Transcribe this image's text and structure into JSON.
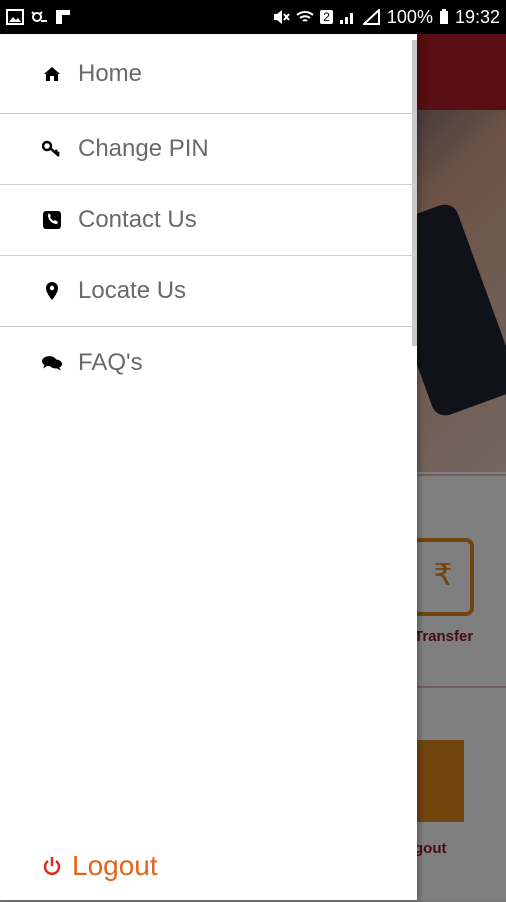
{
  "status_bar": {
    "battery": "100%",
    "time": "19:32",
    "sim_badge": "2"
  },
  "menu": {
    "items": [
      {
        "label": "Home",
        "icon": "home-icon"
      },
      {
        "label": "Change PIN",
        "icon": "key-icon"
      },
      {
        "label": "Contact Us",
        "icon": "phone-icon"
      },
      {
        "label": "Locate Us",
        "icon": "location-pin-icon"
      },
      {
        "label": "FAQ's",
        "icon": "chat-bubbles-icon"
      }
    ],
    "logout_label": "Logout"
  },
  "background": {
    "tile1_label": "Transfer",
    "tile1_symbol": "₹",
    "tile2_label": "gout"
  },
  "colors": {
    "accent": "#e4641c",
    "header_red": "#b01d25",
    "menu_text": "#6a6a6a"
  }
}
